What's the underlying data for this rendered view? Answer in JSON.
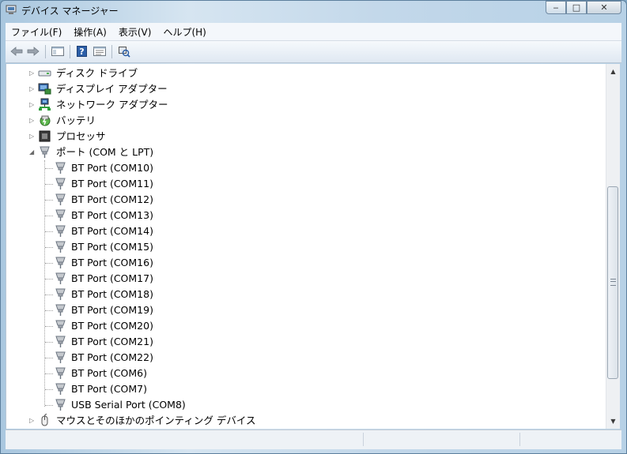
{
  "window": {
    "title": "デバイス マネージャー",
    "caption_buttons": {
      "minimize": "‒",
      "maximize": "□",
      "close": "✕"
    }
  },
  "menu": [
    {
      "label": "ファイル(F)"
    },
    {
      "label": "操作(A)"
    },
    {
      "label": "表示(V)"
    },
    {
      "label": "ヘルプ(H)"
    }
  ],
  "toolbar": {
    "buttons": [
      "back-arrow-icon",
      "forward-arrow-icon",
      "show-hide-console-tree-icon",
      "help-icon",
      "properties-icon",
      "scan-hardware-icon"
    ]
  },
  "tree": {
    "categories": [
      {
        "label": "ディスク ドライブ",
        "expanded": false,
        "icon": "disk-drive-icon"
      },
      {
        "label": "ディスプレイ アダプター",
        "expanded": false,
        "icon": "display-adapter-icon"
      },
      {
        "label": "ネットワーク アダプター",
        "expanded": false,
        "icon": "network-adapter-icon"
      },
      {
        "label": "バッテリ",
        "expanded": false,
        "icon": "battery-icon"
      },
      {
        "label": "プロセッサ",
        "expanded": false,
        "icon": "processor-icon"
      },
      {
        "label": "ポート (COM と LPT)",
        "expanded": true,
        "icon": "port-icon"
      }
    ],
    "ports": [
      "BT Port (COM10)",
      "BT Port (COM11)",
      "BT Port (COM12)",
      "BT Port (COM13)",
      "BT Port (COM14)",
      "BT Port (COM15)",
      "BT Port (COM16)",
      "BT Port (COM17)",
      "BT Port (COM18)",
      "BT Port (COM19)",
      "BT Port (COM20)",
      "BT Port (COM21)",
      "BT Port (COM22)",
      "BT Port (COM6)",
      "BT Port (COM7)",
      "USB Serial Port (COM8)"
    ],
    "after": [
      {
        "label": "マウスとそのほかのポインティング デバイス",
        "expanded": false,
        "icon": "mouse-icon"
      }
    ]
  },
  "scrollbar": {
    "up": "▲",
    "down": "▼"
  },
  "colors": {
    "port_icon": "#8a8f96",
    "accent": "#2b6cb0"
  }
}
